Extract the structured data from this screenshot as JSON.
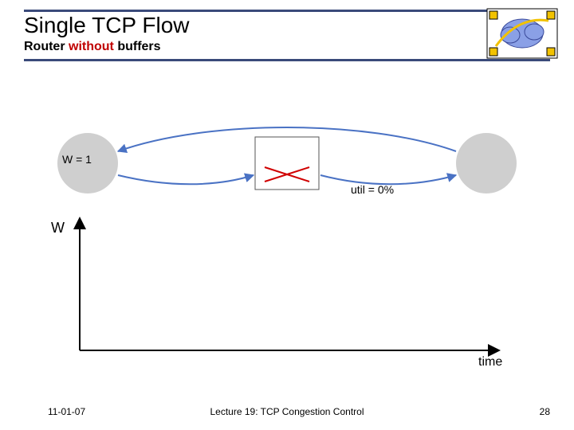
{
  "title": "Single TCP Flow",
  "subtitle_prefix": "Router ",
  "subtitle_highlight": "without",
  "subtitle_suffix": " buffers",
  "diagram": {
    "w_label": "W = 1",
    "util_label": "util = 0%"
  },
  "plot": {
    "y_axis": "W",
    "x_axis": "time"
  },
  "footer": {
    "date": "11-01-07",
    "lecture": "Lecture 19: TCP Congestion Control",
    "page": "28"
  }
}
